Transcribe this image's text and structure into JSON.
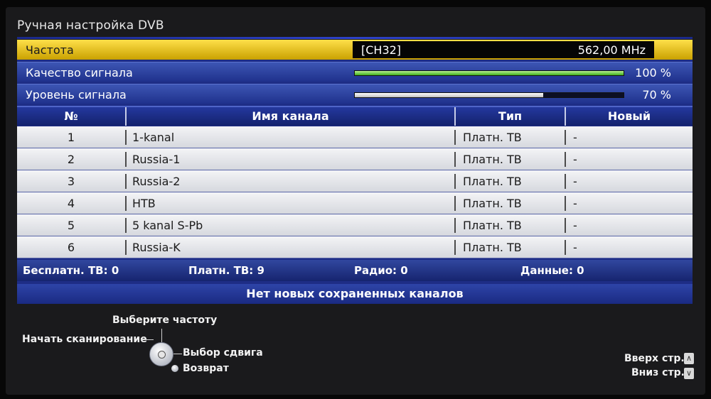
{
  "header": {
    "title": "Ручная настройка DVB"
  },
  "info": {
    "frequency": {
      "label": "Частота",
      "channel": "[CH32]",
      "value": "562,00 MHz"
    },
    "quality": {
      "label": "Качество сигнала",
      "percent_text": "100 %",
      "level": 1.0
    },
    "strength": {
      "label": "Уровень сигнала",
      "percent_text": "70 %",
      "level": 0.7
    }
  },
  "table": {
    "columns": [
      "№",
      "Имя канала",
      "Тип",
      "Новый"
    ],
    "rows": [
      {
        "num": "1",
        "name": "1-kanal",
        "type": "Платн. ТВ",
        "new": "-"
      },
      {
        "num": "2",
        "name": "Russia-1",
        "type": "Платн. ТВ",
        "new": "-"
      },
      {
        "num": "3",
        "name": "Russia-2",
        "type": "Платн. ТВ",
        "new": "-"
      },
      {
        "num": "4",
        "name": "НТВ",
        "type": "Платн. ТВ",
        "new": "-"
      },
      {
        "num": "5",
        "name": "5 kanal S-Pb",
        "type": "Платн. ТВ",
        "new": "-"
      },
      {
        "num": "6",
        "name": "Russia-K",
        "type": "Платн. ТВ",
        "new": "-"
      }
    ]
  },
  "stats": {
    "free_tv": "Бесплатн. ТВ: 0",
    "pay_tv": "Платн. ТВ: 9",
    "radio": "Радио: 0",
    "data": "Данные: 0"
  },
  "status_message": "Нет новых сохраненных каналов",
  "help": {
    "select_frequency": "Выберите частоту",
    "start_scan": "Начать сканирование",
    "shift_select": "Выбор сдвига",
    "back": "Возврат",
    "page_up": "Вверх стр.",
    "page_down": "Вниз стр."
  },
  "icons": {
    "dpad": "dpad-icon",
    "back": "back-button-icon",
    "page_up": "arrow-up-icon",
    "page_down": "arrow-down-icon"
  },
  "colors": {
    "highlight": "#f2c500",
    "panel": "#1e2d86",
    "quality_bar": "#3fae1c",
    "strength_bar": "#d9d9d9"
  }
}
